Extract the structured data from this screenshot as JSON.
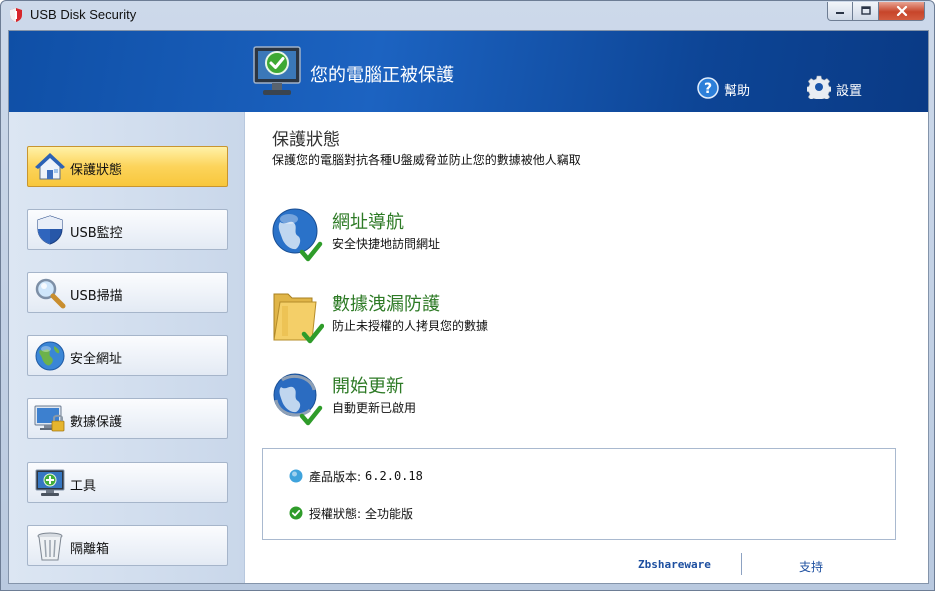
{
  "window": {
    "title": "USB Disk Security",
    "controls": {
      "minimize": "minimize",
      "maximize": "maximize",
      "close": "close"
    }
  },
  "header": {
    "status_text": "您的電腦正被保護",
    "help_label": "幫助",
    "settings_label": "設置"
  },
  "sidebar": {
    "items": [
      {
        "label": "保護狀態",
        "icon": "house-icon",
        "active": true
      },
      {
        "label": "USB監控",
        "icon": "shield-icon",
        "active": false
      },
      {
        "label": "USB掃描",
        "icon": "magnifier-icon",
        "active": false
      },
      {
        "label": "安全網址",
        "icon": "globe-icon",
        "active": false
      },
      {
        "label": "數據保護",
        "icon": "monitor-lock-icon",
        "active": false
      },
      {
        "label": "工具",
        "icon": "monitor-tool-icon",
        "active": false
      },
      {
        "label": "隔離箱",
        "icon": "trash-bin-icon",
        "active": false
      }
    ]
  },
  "main": {
    "section_title": "保護狀態",
    "section_desc": "保護您的電腦對抗各種U盤威脅並防止您的數據被他人竊取",
    "features": [
      {
        "title": "網址導航",
        "desc": "安全快捷地訪問網址",
        "icon": "globe-check-icon"
      },
      {
        "title": "數據洩漏防護",
        "desc": "防止未授權的人拷貝您的數據",
        "icon": "folder-check-icon"
      },
      {
        "title": "開始更新",
        "desc": "自動更新已啟用",
        "icon": "globe-update-check-icon"
      }
    ],
    "info": {
      "version_label": "產品版本:",
      "version_value": "6.2.0.18",
      "license_label": "授權狀態:",
      "license_value": "全功能版"
    },
    "footer": {
      "link1": "Zbshareware",
      "link2": "支持"
    }
  },
  "colors": {
    "header_blue": "#1456b0",
    "active_nav": "#fcd45b",
    "feature_green": "#2d7a25"
  }
}
